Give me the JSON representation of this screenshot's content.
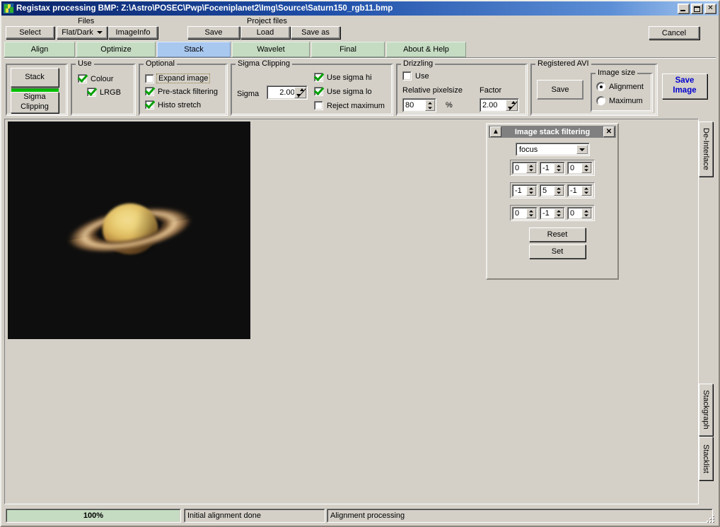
{
  "window": {
    "title": "Registax processing BMP: Z:\\Astro\\POSEC\\Pwp\\Foceniplanet2\\Img\\Source\\Saturn150_rgb11.bmp",
    "icon": "registax-logo-icon",
    "minimize": "_",
    "maximize": "□",
    "close": "✕"
  },
  "toolbar": {
    "files_caption": "Files",
    "select": "Select",
    "flat_dark": "Flat/Dark",
    "image_info": "ImageInfo",
    "project_caption": "Project files",
    "save": "Save",
    "load": "Load",
    "save_as": "Save as",
    "cancel": "Cancel"
  },
  "tabs": [
    {
      "label": "Align",
      "active": false
    },
    {
      "label": "Optimize",
      "active": false
    },
    {
      "label": "Stack",
      "active": true
    },
    {
      "label": "Wavelet",
      "active": false
    },
    {
      "label": "Final",
      "active": false
    },
    {
      "label": "About & Help",
      "active": false
    }
  ],
  "actions": {
    "stack": "Stack",
    "sigma_clipping": "Sigma\nClipping",
    "sigma_clipping_line1": "Sigma",
    "sigma_clipping_line2": "Clipping",
    "save_image_line1": "Save",
    "save_image_line2": "Image",
    "save_image_color": "#0000cd"
  },
  "use_group": {
    "caption": "Use",
    "colour": {
      "label": "Colour",
      "checked": true
    },
    "lrgb": {
      "label": "LRGB",
      "checked": true
    }
  },
  "optional_group": {
    "caption": "Optional",
    "expand_image": {
      "label": "Expand image",
      "checked": false,
      "focused": true
    },
    "pre_stack_filtering": {
      "label": "Pre-stack filtering",
      "checked": true,
      "focused": false
    },
    "histo_stretch": {
      "label": "Histo stretch",
      "checked": true,
      "focused": false
    }
  },
  "sigma_group": {
    "caption": "Sigma Clipping",
    "sigma_label": "Sigma",
    "sigma_value": "2.00",
    "use_sigma_hi": {
      "label": "Use sigma hi",
      "checked": true
    },
    "use_sigma_lo": {
      "label": "Use sigma lo",
      "checked": true
    },
    "reject_maximum": {
      "label": "Reject maximum",
      "checked": false
    }
  },
  "drizzling_group": {
    "caption": "Drizzling",
    "use": {
      "label": "Use",
      "checked": false
    },
    "relative_pixelsize_label": "Relative pixelsize",
    "relative_pixelsize_value": "80",
    "percent": "%",
    "factor_label": "Factor",
    "factor_value": "2.00"
  },
  "avi_group": {
    "caption": "Registered AVI",
    "save": "Save",
    "image_size_caption": "Image size",
    "alignment": {
      "label": "Alignment",
      "selected": true
    },
    "maximum": {
      "label": "Maximum",
      "selected": false
    }
  },
  "filter_dialog": {
    "title": "Image stack filtering",
    "collapse_glyph": "▲",
    "close_glyph": "✕",
    "filter_selected": "focus",
    "kernel": [
      [
        "0",
        "-1",
        "0"
      ],
      [
        "-1",
        "5",
        "-1"
      ],
      [
        "0",
        "-1",
        "0"
      ]
    ],
    "reset": "Reset",
    "set": "Set"
  },
  "side_tabs": [
    {
      "label": "De-Interlace"
    },
    {
      "label": "Stackgraph"
    },
    {
      "label": "Stacklist"
    }
  ],
  "image_preview": {
    "subject": "Saturn",
    "background_color": "#0e0e0e"
  },
  "statusbar": {
    "progress_text": "100%",
    "progress_percent": 100,
    "message_left": "Initial alignment done",
    "message_right": "Alignment processing"
  }
}
